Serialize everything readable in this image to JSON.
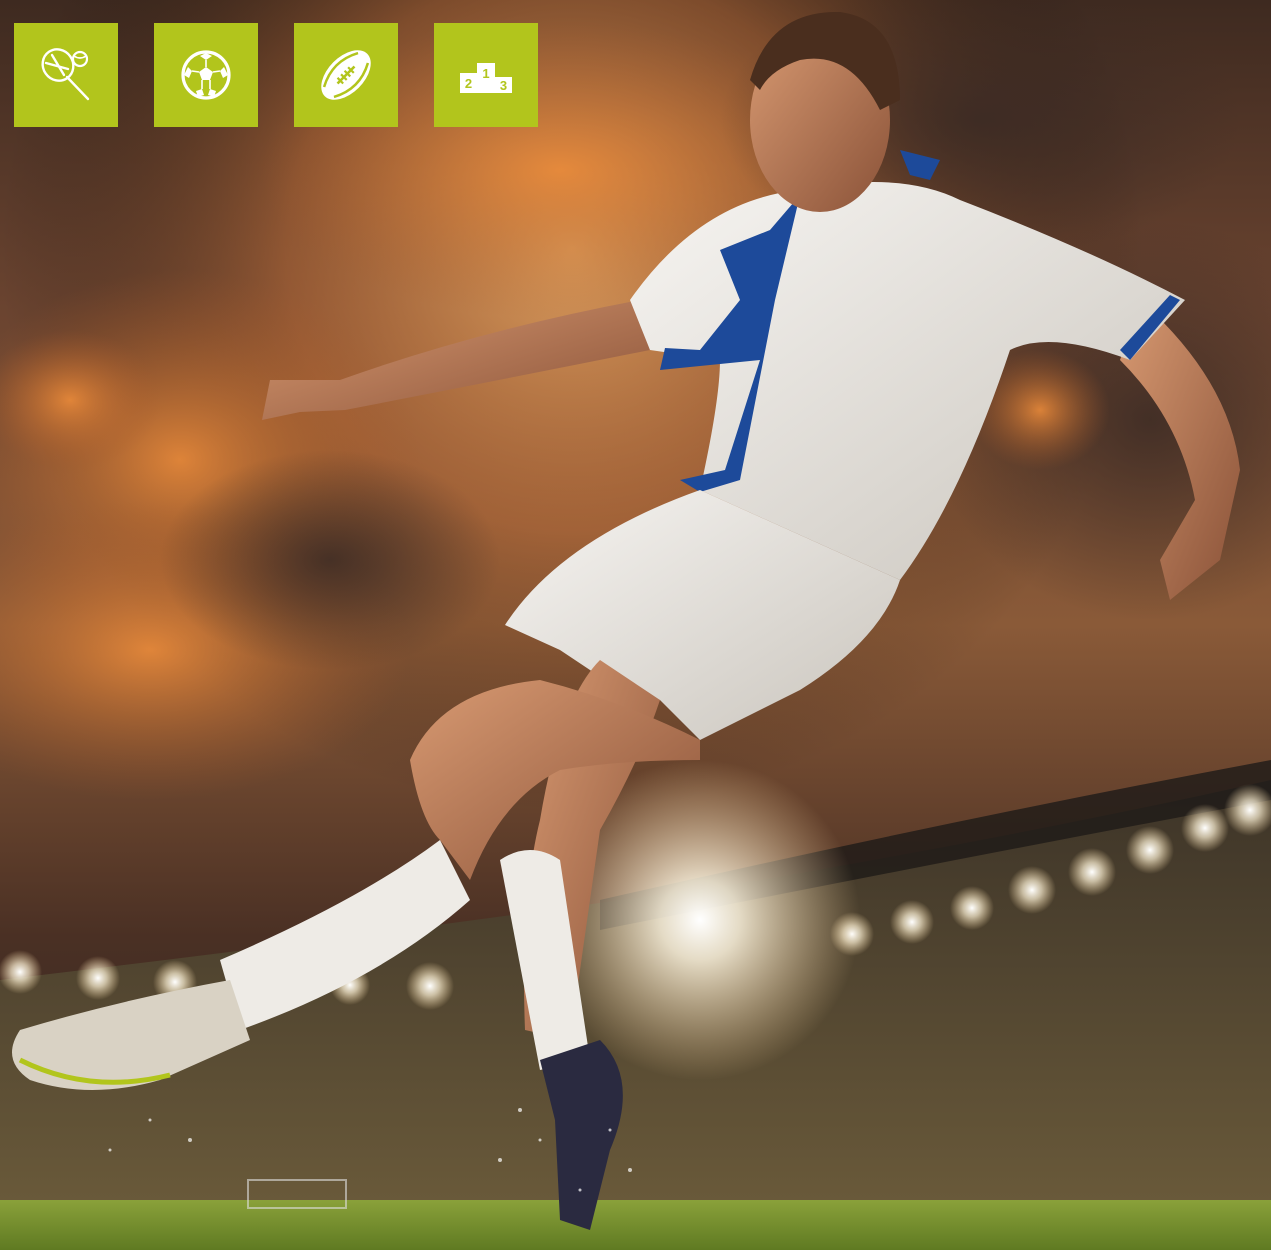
{
  "colors": {
    "tile_background": "#b2c51c",
    "icon_foreground": "#ffffff",
    "jersey_accent": "#1d4a9a",
    "sky_glow": "#e07a26",
    "pitch_green": "#7f9a2c"
  },
  "sport_tiles": [
    {
      "icon": "tennis-icon"
    },
    {
      "icon": "soccer-ball-icon"
    },
    {
      "icon": "american-football-icon"
    },
    {
      "icon": "podium-icon",
      "places": [
        "2",
        "1",
        "3"
      ]
    }
  ],
  "photo": {
    "subject": "football-player-kicking-in-stadium"
  }
}
